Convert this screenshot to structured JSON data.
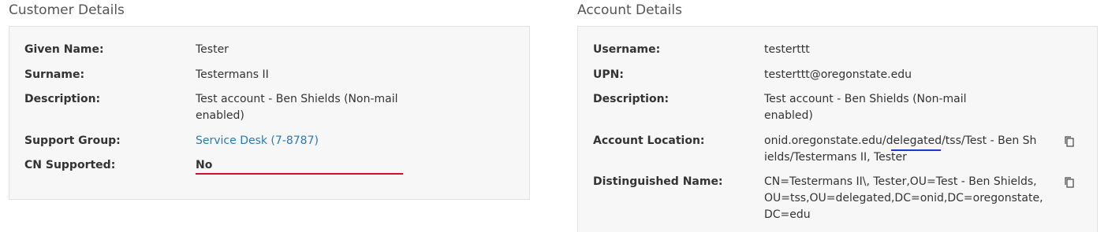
{
  "customer": {
    "title": "Customer Details",
    "given_name_label": "Given Name:",
    "given_name": "Tester",
    "surname_label": "Surname:",
    "surname": "Testermans II",
    "description_label": "Description:",
    "description_line1": "Test account - Ben Shields (Non-mail",
    "description_line2": "enabled)",
    "support_group_label": "Support Group:",
    "support_group": "Service Desk (7-8787)",
    "cn_supported_label": "CN Supported:",
    "cn_supported": "No"
  },
  "account": {
    "title": "Account Details",
    "username_label": "Username:",
    "username": "testerttt",
    "upn_label": "UPN:",
    "upn": "testerttt@oregonstate.edu",
    "description_label": "Description:",
    "description_line1": "Test account - Ben Shields (Non-mail",
    "description_line2": "enabled)",
    "location_label": "Account Location:",
    "location_line1": "onid.oregonstate.edu/delegated/tss/Test - Ben Sh",
    "location_line2": "ields/Testermans II, Tester",
    "dn_label": "Distinguished Name:",
    "dn_line1": "CN=Testermans II\\, Tester,OU=Test - Ben Shields,",
    "dn_line2": "OU=tss,OU=delegated,DC=onid,DC=oregonstate,",
    "dn_line3": "DC=edu"
  },
  "icons": {
    "copy": "copy-icon"
  },
  "colors": {
    "link": "#2a7ab5",
    "red_underline": "#d0102a",
    "blue_underline": "#1c39c9",
    "panel_bg": "#f7f7f7"
  }
}
